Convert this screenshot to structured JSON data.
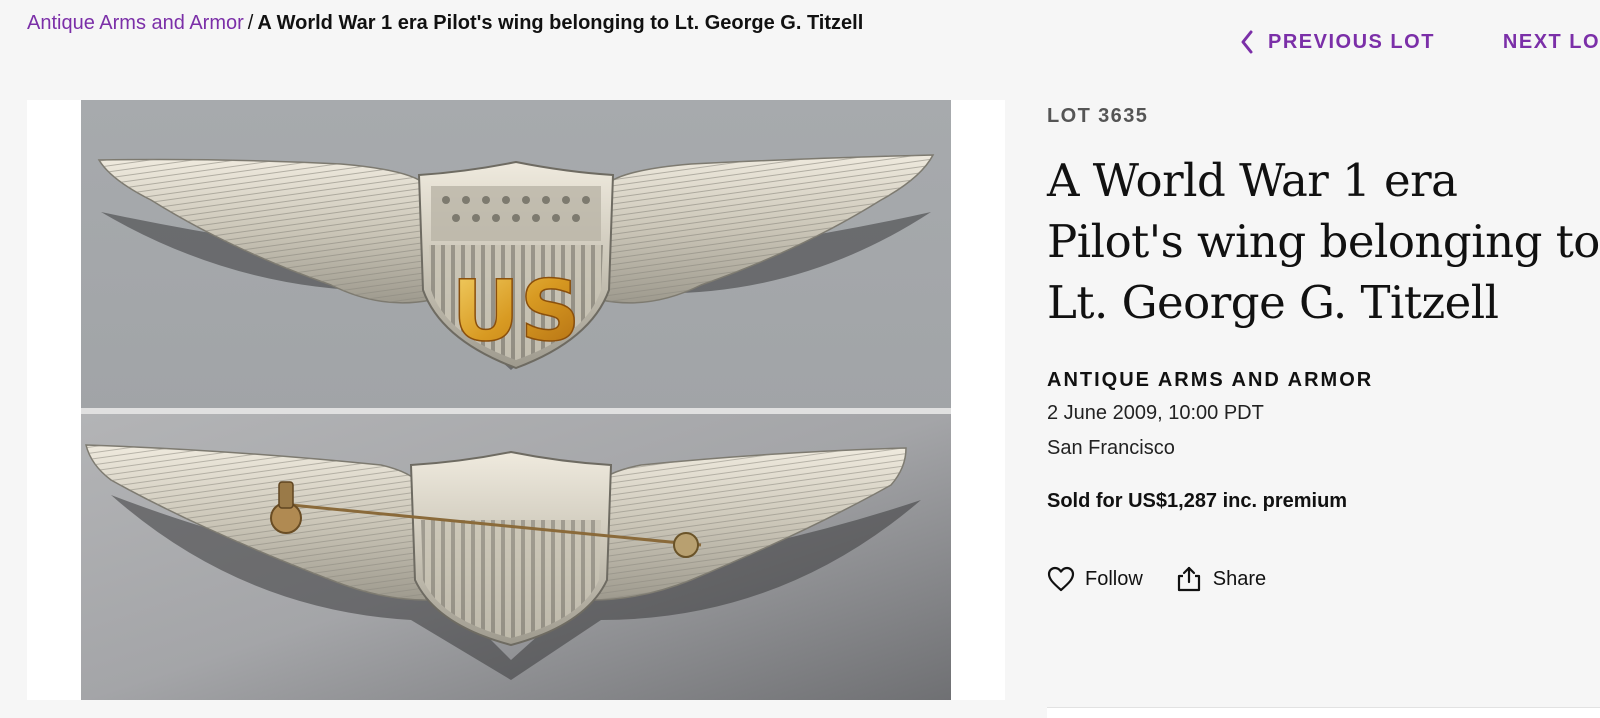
{
  "breadcrumb": {
    "category": "Antique Arms and Armor",
    "separator": "/",
    "current": "A World War 1 era Pilot's wing belonging to Lt. George G. Titzell"
  },
  "lot_nav": {
    "previous_label": "PREVIOUS LOT",
    "next_label": "NEXT LOT",
    "prev_icon": "chevron-left-icon"
  },
  "lot": {
    "number": "LOT 3635",
    "title": "A World War 1 era Pilot's wing belonging to Lt. George G. Titzell",
    "sale_name": "ANTIQUE ARMS AND ARMOR",
    "date": "2 June 2009, 10:00 PDT",
    "location": "San Francisco",
    "sold_price": "Sold for US$1,287 inc. premium"
  },
  "actions": {
    "follow_label": "Follow",
    "follow_icon": "heart-icon",
    "share_label": "Share",
    "share_icon": "share-icon"
  },
  "image": {
    "badge_text": "US"
  },
  "colors": {
    "accent": "#7b2fa8",
    "background": "#f6f6f6"
  }
}
